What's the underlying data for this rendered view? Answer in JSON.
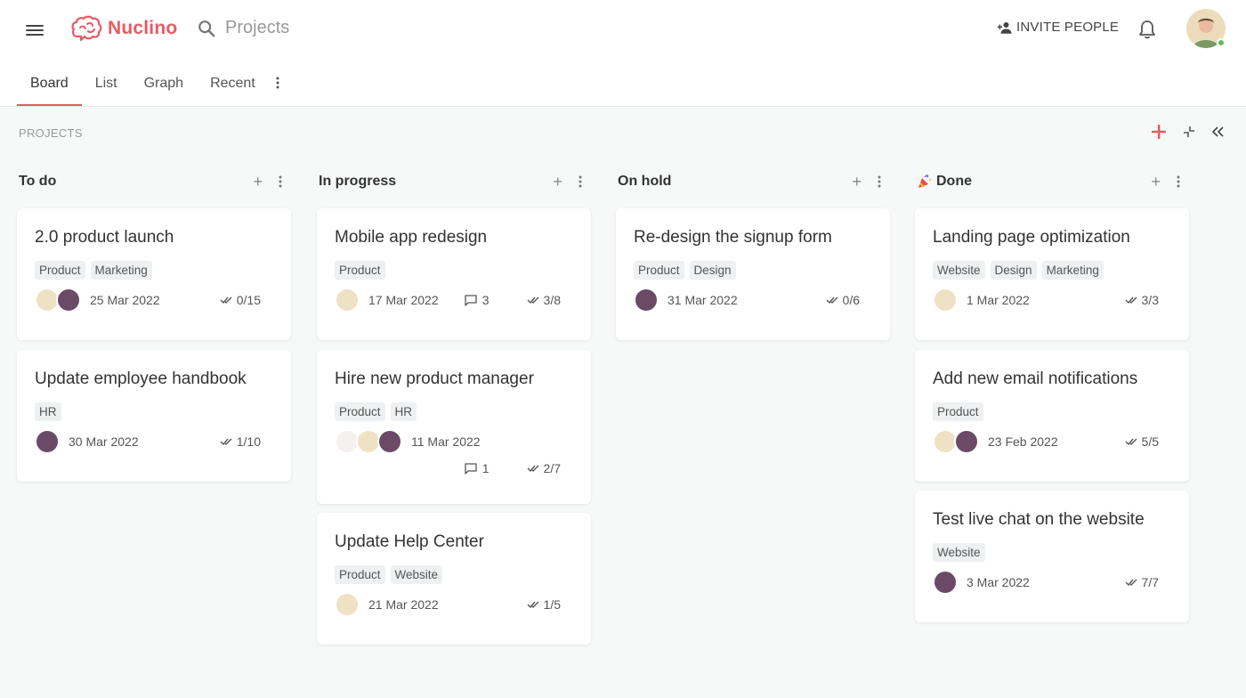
{
  "app": {
    "name": "Nuclino"
  },
  "search": {
    "label": "Projects"
  },
  "header": {
    "invite_label": "INVITE PEOPLE"
  },
  "tabs": [
    {
      "label": "Board"
    },
    {
      "label": "List"
    },
    {
      "label": "Graph"
    },
    {
      "label": "Recent"
    }
  ],
  "board": {
    "title": "PROJECTS"
  },
  "columns": [
    {
      "title": "To do",
      "cards": [
        {
          "title": "2.0 product launch",
          "tags": [
            "Product",
            "Marketing"
          ],
          "date": "25 Mar 2022",
          "tasks": "0/15"
        },
        {
          "title": "Update employee handbook",
          "tags": [
            "HR"
          ],
          "date": "30 Mar 2022",
          "tasks": "1/10"
        }
      ]
    },
    {
      "title": "In progress",
      "cards": [
        {
          "title": "Mobile app redesign",
          "tags": [
            "Product"
          ],
          "date": "17 Mar 2022",
          "comments": "3",
          "tasks": "3/8"
        },
        {
          "title": "Hire new product manager",
          "tags": [
            "Product",
            "HR"
          ],
          "date": "11 Mar 2022",
          "comments": "1",
          "tasks": "2/7"
        },
        {
          "title": "Update Help Center",
          "tags": [
            "Product",
            "Website"
          ],
          "date": "21 Mar 2022",
          "tasks": "1/5"
        }
      ]
    },
    {
      "title": "On hold",
      "cards": [
        {
          "title": "Re-design the signup form",
          "tags": [
            "Product",
            "Design"
          ],
          "date": "31 Mar 2022",
          "tasks": "0/6"
        }
      ]
    },
    {
      "title": "Done",
      "cards": [
        {
          "title": "Landing page optimization",
          "tags": [
            "Website",
            "Design",
            "Marketing"
          ],
          "date": "1 Mar 2022",
          "tasks": "3/3"
        },
        {
          "title": "Add new email notifications",
          "tags": [
            "Product"
          ],
          "date": "23 Feb 2022",
          "tasks": "5/5"
        },
        {
          "title": "Test live chat on the website",
          "tags": [
            "Website"
          ],
          "date": "3 Mar 2022",
          "tasks": "7/7"
        }
      ]
    }
  ],
  "colors": {
    "accent": "#e85a64",
    "online": "#5ac05a"
  },
  "icons": [
    "menu-icon",
    "brain-logo-icon",
    "search-icon",
    "add-person-icon",
    "bell-icon",
    "more-vertical-icon",
    "plus-icon",
    "collapse-icon",
    "double-chevron-left-icon",
    "party-popper-icon",
    "comment-icon",
    "double-check-icon"
  ]
}
